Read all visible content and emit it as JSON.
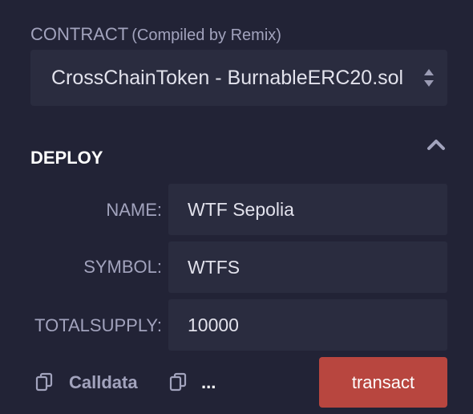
{
  "contract": {
    "label": "CONTRACT",
    "sublabel": "(Compiled by Remix)",
    "selected": "CrossChainToken - BurnableERC20.sol"
  },
  "deploy": {
    "title": "DEPLOY",
    "collapse_icon": "chevron-up-icon",
    "fields": [
      {
        "label": "NAME:",
        "value": "WTF Sepolia"
      },
      {
        "label": "SYMBOL:",
        "value": "WTFS"
      },
      {
        "label": "TOTALSUPPLY:",
        "value": "10000"
      }
    ]
  },
  "footer": {
    "copy_icon": "copy-icon",
    "calldata_label": "Calldata",
    "dots_label": "...",
    "transact_label": "transact"
  },
  "colors": {
    "background": "#222336",
    "input_background": "#2a2c3f",
    "label": "#a2a3bd",
    "text": "#e2e2ec",
    "transact": "#b8463f"
  }
}
